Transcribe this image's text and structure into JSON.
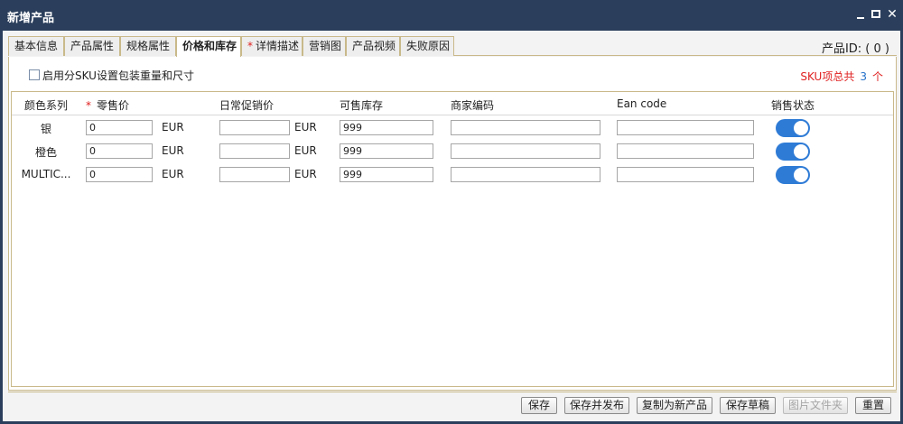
{
  "window": {
    "title": "新增产品"
  },
  "tabs": [
    {
      "label": "基本信息",
      "required": false
    },
    {
      "label": "产品属性",
      "required": false
    },
    {
      "label": "规格属性",
      "required": false
    },
    {
      "label": "价格和库存",
      "required": false
    },
    {
      "label": "详情描述",
      "required": true
    },
    {
      "label": "营销图",
      "required": false
    },
    {
      "label": "产品视频",
      "required": false
    },
    {
      "label": "失败原因",
      "required": false
    }
  ],
  "active_tab": "价格和库存",
  "product_id": "产品ID: ( 0 )",
  "sku_checkbox": {
    "label": "启用分SKU设置包装重量和尺寸",
    "checked": false
  },
  "sku_count": {
    "prefix": "SKU项总共",
    "count": "3",
    "suffix": "个"
  },
  "columns": {
    "color": "颜色系列",
    "retail_price": "零售价",
    "promo_price": "日常促销价",
    "stock": "可售库存",
    "merchant_code": "商家编码",
    "ean": "Ean code",
    "sale_status": "销售状态"
  },
  "currency": "EUR",
  "rows": [
    {
      "color": "银",
      "retail_price": "0",
      "promo_price": "",
      "stock": "999",
      "merchant_code": "",
      "ean": "",
      "on_sale": true
    },
    {
      "color": "橙色",
      "retail_price": "0",
      "promo_price": "",
      "stock": "999",
      "merchant_code": "",
      "ean": "",
      "on_sale": true
    },
    {
      "color": "MULTIC...",
      "retail_price": "0",
      "promo_price": "",
      "stock": "999",
      "merchant_code": "",
      "ean": "",
      "on_sale": true
    }
  ],
  "buttons": {
    "save": "保存",
    "save_publish": "保存并发布",
    "copy_new": "复制为新产品",
    "save_draft": "保存草稿",
    "image_folder": "图片文件夹",
    "reset": "重置"
  },
  "colors": {
    "titlebar": "#2b3f5c",
    "toggle_on": "#2e7bd6",
    "required": "#e02020",
    "count": "#2570c9"
  }
}
